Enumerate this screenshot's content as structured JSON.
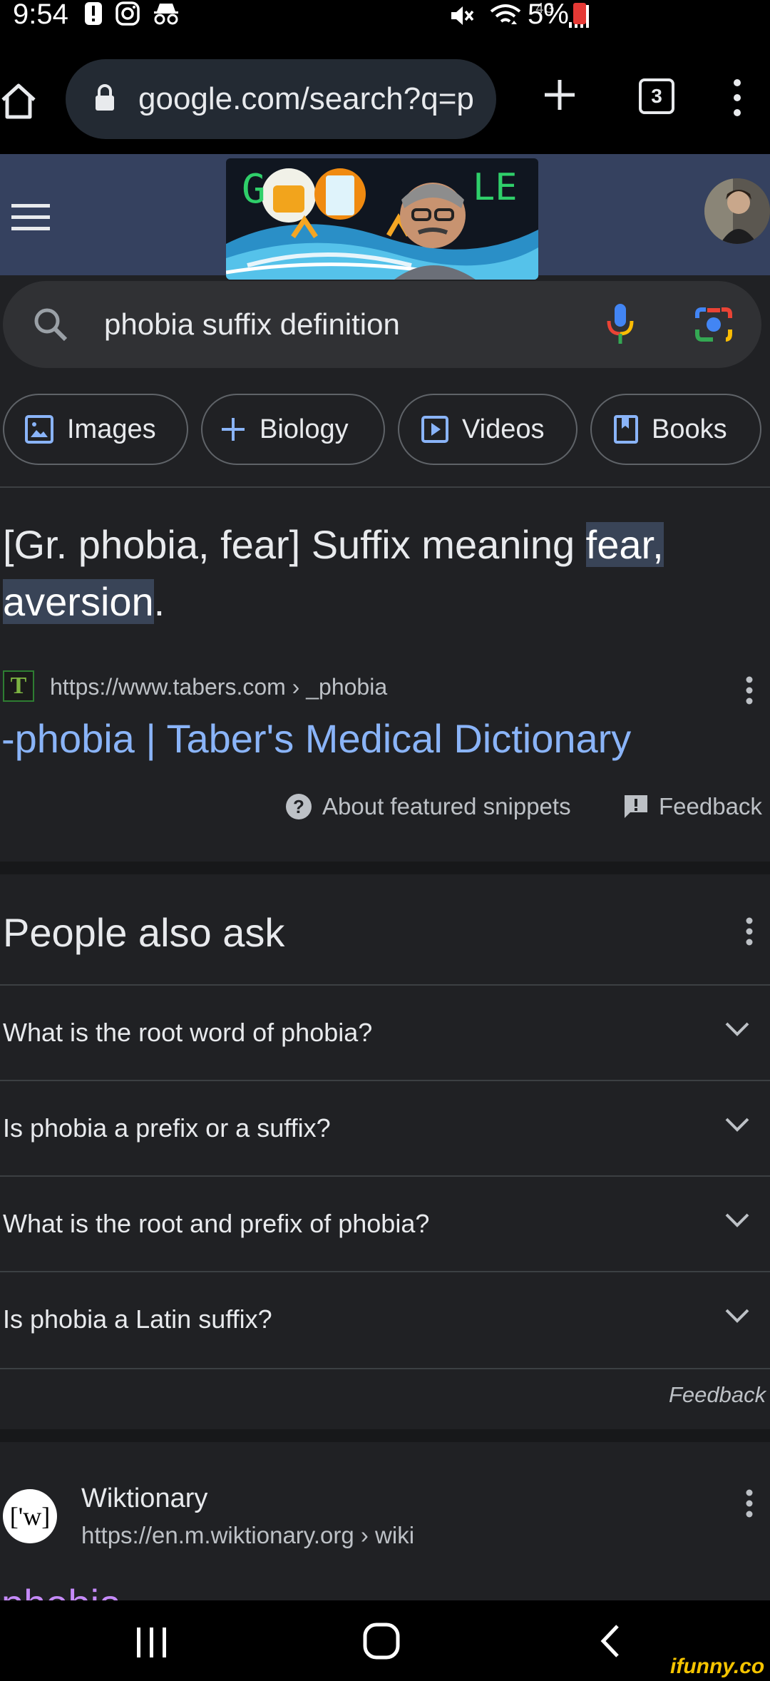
{
  "status_bar": {
    "time": "9:54",
    "battery": "5%",
    "network": "4G",
    "icons": [
      "alert-icon",
      "instagram-icon",
      "incognito-icon",
      "mute-icon",
      "wifi-icon",
      "signal-icon",
      "battery-low-icon"
    ]
  },
  "browser": {
    "url": "google.com/search?q=p",
    "tab_count": "3"
  },
  "header": {
    "doodle_text_left": "G",
    "doodle_text_right": "LE"
  },
  "search": {
    "query": "phobia suffix definition"
  },
  "chips": [
    {
      "label": "Images",
      "icon": "image-icon"
    },
    {
      "label": "Biology",
      "icon": "plus-icon"
    },
    {
      "label": "Videos",
      "icon": "play-icon"
    },
    {
      "label": "Books",
      "icon": "book-icon"
    }
  ],
  "snippet": {
    "text_before": "[Gr. phobia, fear] Suffix meaning ",
    "highlight_1": "fear,",
    "highlight_2": "aversion",
    "text_after": ".",
    "favicon_letter": "T",
    "source_url": "https://www.tabers.com › _phobia",
    "title": "-phobia | Taber's Medical Dictionary",
    "about_label": "About featured snippets",
    "feedback_label": "Feedback"
  },
  "people_also_ask": {
    "title": "People also ask",
    "questions": [
      "What is the root word of phobia?",
      "Is phobia a prefix or a suffix?",
      "What is the root and prefix of phobia?",
      "Is phobia a Latin suffix?"
    ],
    "feedback_label": "Feedback"
  },
  "wiktionary": {
    "favicon": "['w]",
    "name": "Wiktionary",
    "url": "https://en.m.wiktionary.org › wiki",
    "title": "phobia"
  },
  "watermark": "ifunny.co",
  "colors": {
    "page_bg": "#202124",
    "header_bg": "#35415f",
    "link": "#8ab4f8",
    "visited": "#c58af9",
    "highlight": "#394457"
  }
}
